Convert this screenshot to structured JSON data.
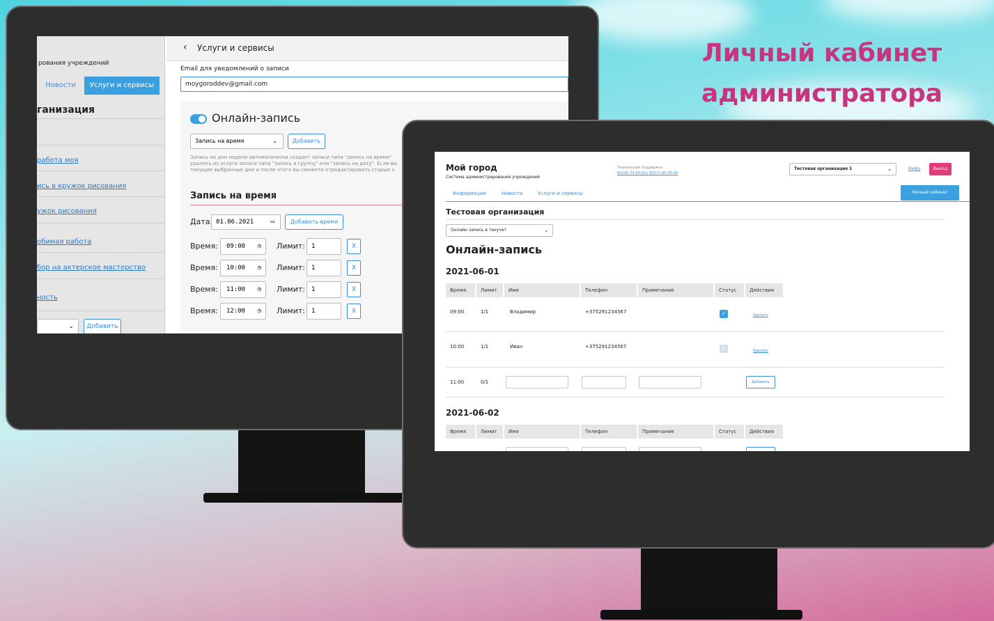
{
  "headline": {
    "line1": "Личный кабинет",
    "line2": "администратора"
  },
  "left_screen": {
    "sidebar": {
      "subtitle": "рования учреждений",
      "tab_news": "Новости",
      "tab_services": "Услуги и сервисы",
      "org_title": "ганизация",
      "links": [
        "работа моя",
        "ись в кружок рисования",
        "ужок рисования",
        "обимая работа",
        "бор на актерское мастерство",
        "ность"
      ],
      "add_label": "Добавить",
      "chevron_icon": "chevron-down-icon"
    },
    "topbar": {
      "back_icon": "‹",
      "title": "Услуги и сервисы"
    },
    "email": {
      "label": "Email для уведомлений о записи",
      "value": "moygoroddev@gmail.com"
    },
    "online": {
      "title": "Онлайн-запись",
      "toggle_on": true,
      "select_value": "Запись на время",
      "add_label": "Добавить",
      "note": "Запись на дни недели автоматически создает записи типа \"запись на время\" удалить из услуги записи типа \"запись в группу\" или \"запись на дату\". Если вы текущие выбранные дни и после этого вы сможете отредактировать старые з",
      "subtitle": "Запись на время",
      "date_label": "Дата:",
      "date_value": "01.06.2021",
      "add_time_label": "Добавить время",
      "time_label": "Время:",
      "limit_label": "Лимит:",
      "remove_label": "X",
      "slots": [
        {
          "time": "09:00",
          "limit": "1"
        },
        {
          "time": "10:00",
          "limit": "1"
        },
        {
          "time": "11:00",
          "limit": "1"
        },
        {
          "time": "12:00",
          "limit": "1"
        }
      ]
    }
  },
  "right_screen": {
    "header": {
      "logo": "Мой город",
      "logo_sub": "Система администрирования учреждений",
      "support_label": "Техническая поддержка",
      "support_phones": "8(029)-74-00-00 | 8(017)-45-55-99",
      "org_select": "Тестовая организация 1",
      "info_link": "Инфо",
      "exit_label": "Выход"
    },
    "nav": {
      "info": "Информация",
      "news": "Новости",
      "services": "Услуги и сервисы",
      "cabinet": "Личный кабинет"
    },
    "org_title": "Тестовая организация",
    "filter_select": "Онлайн запись в текучет",
    "page_title": "Онлайн-запись",
    "columns": [
      "Время",
      "Лимит",
      "Имя",
      "Телефон",
      "Примечание",
      "Статус",
      "Действия"
    ],
    "days": [
      {
        "date": "2021-06-01",
        "rows": [
          {
            "time": "09:00",
            "limit": "1/1",
            "name": "Владимир",
            "phone": "+375291234567",
            "status": "checked",
            "action": "Удалить"
          },
          {
            "time": "10:00",
            "limit": "1/1",
            "name": "Иван",
            "phone": "+375291234567",
            "status": "disabled",
            "action": "Удалить"
          },
          {
            "time": "11:00",
            "limit": "0/1",
            "name": "",
            "phone": "",
            "status": "",
            "action": "Добавить"
          }
        ]
      },
      {
        "date": "2021-06-02",
        "rows": []
      }
    ]
  }
}
